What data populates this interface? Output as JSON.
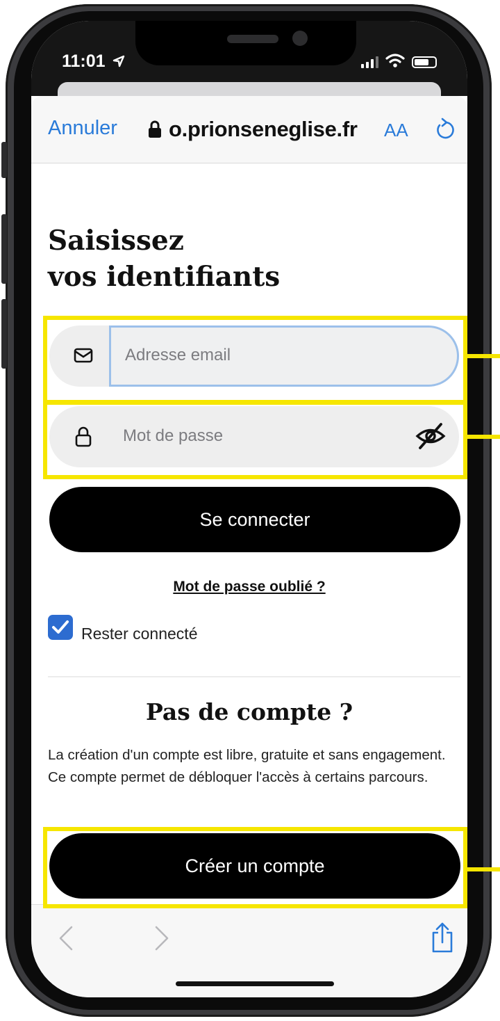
{
  "status_bar": {
    "time": "11:01"
  },
  "browser": {
    "cancel_label": "Annuler",
    "url": "o.prionseneglise.fr",
    "text_size_label": "AA"
  },
  "page": {
    "title_line1": "Saisissez",
    "title_line2": "vos identifiants",
    "email_placeholder": "Adresse email",
    "password_placeholder": "Mot de passe",
    "login_button": "Se connecter",
    "forgot_link": "Mot de passe oublié ?",
    "remember_label": "Rester connecté",
    "remember_checked": true,
    "no_account_title": "Pas de compte ?",
    "no_account_text": "La création d'un compte est libre, gratuite et sans engagement. Ce compte permet de débloquer l'accès à certains parcours.",
    "create_button": "Créer un compte"
  },
  "colors": {
    "link_blue": "#2a7bd9",
    "highlight_yellow": "#f6e600",
    "checkbox_blue": "#2d6cd0",
    "button_black": "#000000"
  },
  "icons": [
    "location-arrow-icon",
    "signal-icon",
    "wifi-icon",
    "battery-icon",
    "lock-icon",
    "reload-icon",
    "mail-icon",
    "padlock-icon",
    "eye-off-icon",
    "check-icon",
    "chevron-left-icon",
    "chevron-right-icon",
    "share-icon"
  ]
}
